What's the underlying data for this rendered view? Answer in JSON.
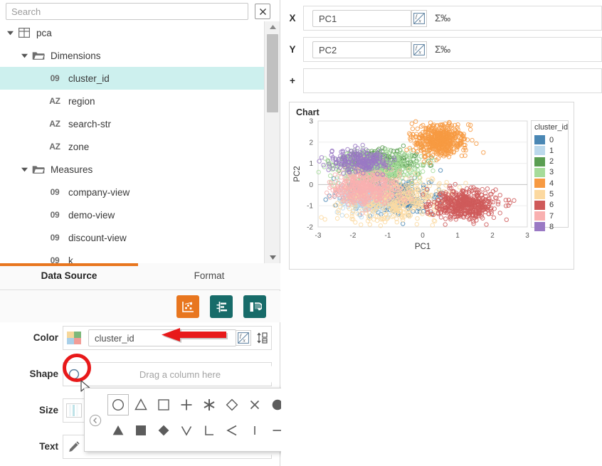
{
  "search": {
    "placeholder": "Search",
    "value": ""
  },
  "tree": {
    "nodes": [
      {
        "label": "pca",
        "type": "table",
        "indent": 0,
        "caret": "down",
        "selected": false
      },
      {
        "label": "Dimensions",
        "type": "folder",
        "indent": 1,
        "caret": "down",
        "selected": false
      },
      {
        "label": "cluster_id",
        "type": "number",
        "indent": 2,
        "caret": "none",
        "selected": true,
        "badge": "09"
      },
      {
        "label": "region",
        "type": "string",
        "indent": 2,
        "caret": "none",
        "selected": false,
        "badge": "AZ"
      },
      {
        "label": "search-str",
        "type": "string",
        "indent": 2,
        "caret": "none",
        "selected": false,
        "badge": "AZ"
      },
      {
        "label": "zone",
        "type": "string",
        "indent": 2,
        "caret": "none",
        "selected": false,
        "badge": "AZ"
      },
      {
        "label": "Measures",
        "type": "folder",
        "indent": 1,
        "caret": "down",
        "selected": false
      },
      {
        "label": "company-view",
        "type": "number",
        "indent": 2,
        "caret": "none",
        "selected": false,
        "badge": "09"
      },
      {
        "label": "demo-view",
        "type": "number",
        "indent": 2,
        "caret": "none",
        "selected": false,
        "badge": "09"
      },
      {
        "label": "discount-view",
        "type": "number",
        "indent": 2,
        "caret": "none",
        "selected": false,
        "badge": "09"
      },
      {
        "label": "k",
        "type": "number",
        "indent": 2,
        "caret": "none",
        "selected": false,
        "badge": "09"
      }
    ]
  },
  "tabs": {
    "active": "Data Source",
    "inactive": "Format",
    "accent": "#e8761f"
  },
  "marks_toolbar": {
    "buttons": [
      {
        "name": "scatter-plot",
        "active": true,
        "color": "#e8761f"
      },
      {
        "name": "filter",
        "active": false,
        "color": "#176b69"
      },
      {
        "name": "swap-axes",
        "active": false,
        "color": "#176b69"
      }
    ]
  },
  "marks": {
    "rows": [
      {
        "label": "Color",
        "value": "cluster_id",
        "is_placeholder": false,
        "icon": "color-palette-icon"
      },
      {
        "label": "Shape",
        "value": "Drag a column here",
        "is_placeholder": true,
        "icon": "circle-shape-icon"
      },
      {
        "label": "Size",
        "value": "",
        "is_placeholder": true,
        "icon": "size-bars-icon"
      },
      {
        "label": "Text",
        "value": "",
        "is_placeholder": true,
        "icon": "pencil-icon"
      }
    ]
  },
  "shape_picker": {
    "selected_index": 0,
    "shapes": [
      "circle-outline",
      "triangle-outline",
      "square-outline",
      "plus",
      "asterisk",
      "diamond-outline",
      "cross-x",
      "circle-filled",
      "triangle-filled",
      "square-filled",
      "diamond-filled",
      "chevron-down",
      "corner-l",
      "less-than",
      "vertical-bar",
      "horizontal-dash"
    ]
  },
  "encodings": {
    "rows": [
      {
        "letter": "X",
        "value": "PC1",
        "agg": "Σ‰"
      },
      {
        "letter": "Y",
        "value": "PC2",
        "agg": "Σ‰"
      },
      {
        "letter": "+",
        "value": "",
        "agg": ""
      }
    ]
  },
  "chart_data": {
    "type": "scatter",
    "title": "Chart",
    "xlabel": "PC1",
    "ylabel": "PC2",
    "xlim": [
      -3,
      3
    ],
    "ylim": [
      -2,
      3
    ],
    "xticks": [
      -3,
      -2,
      -1,
      0,
      1,
      2,
      3
    ],
    "yticks": [
      -2,
      -1,
      0,
      1,
      2,
      3
    ],
    "grid": true,
    "marker": "open-circle",
    "legend": {
      "title": "cluster_id",
      "position": "right"
    },
    "series": [
      {
        "name": "0",
        "color": "#4a87b4",
        "n": 430,
        "center": [
          -0.95,
          -0.55
        ],
        "spread": [
          0.62,
          0.36
        ]
      },
      {
        "name": "1",
        "color": "#bcd9ec",
        "n": 330,
        "center": [
          -1.62,
          -0.66
        ],
        "spread": [
          0.42,
          0.33
        ]
      },
      {
        "name": "2",
        "color": "#5a9e52",
        "n": 360,
        "center": [
          -1.22,
          1.02
        ],
        "spread": [
          0.5,
          0.3
        ]
      },
      {
        "name": "3",
        "color": "#a6dc9a",
        "n": 430,
        "center": [
          -1.3,
          0.8
        ],
        "spread": [
          0.6,
          0.38
        ]
      },
      {
        "name": "4",
        "color": "#f79a42",
        "n": 520,
        "center": [
          0.5,
          2.1
        ],
        "spread": [
          0.36,
          0.38
        ]
      },
      {
        "name": "5",
        "color": "#fcd9a0",
        "n": 420,
        "center": [
          -0.72,
          -0.75
        ],
        "spread": [
          0.7,
          0.55
        ]
      },
      {
        "name": "6",
        "color": "#cf5a5a",
        "n": 520,
        "center": [
          1.25,
          -0.95
        ],
        "spread": [
          0.45,
          0.33
        ]
      },
      {
        "name": "7",
        "color": "#f9b0b0",
        "n": 420,
        "center": [
          -1.62,
          -0.1
        ],
        "spread": [
          0.48,
          0.4
        ]
      },
      {
        "name": "8",
        "color": "#9a79c4",
        "n": 230,
        "center": [
          -1.8,
          1.1
        ],
        "spread": [
          0.42,
          0.28
        ]
      }
    ]
  }
}
